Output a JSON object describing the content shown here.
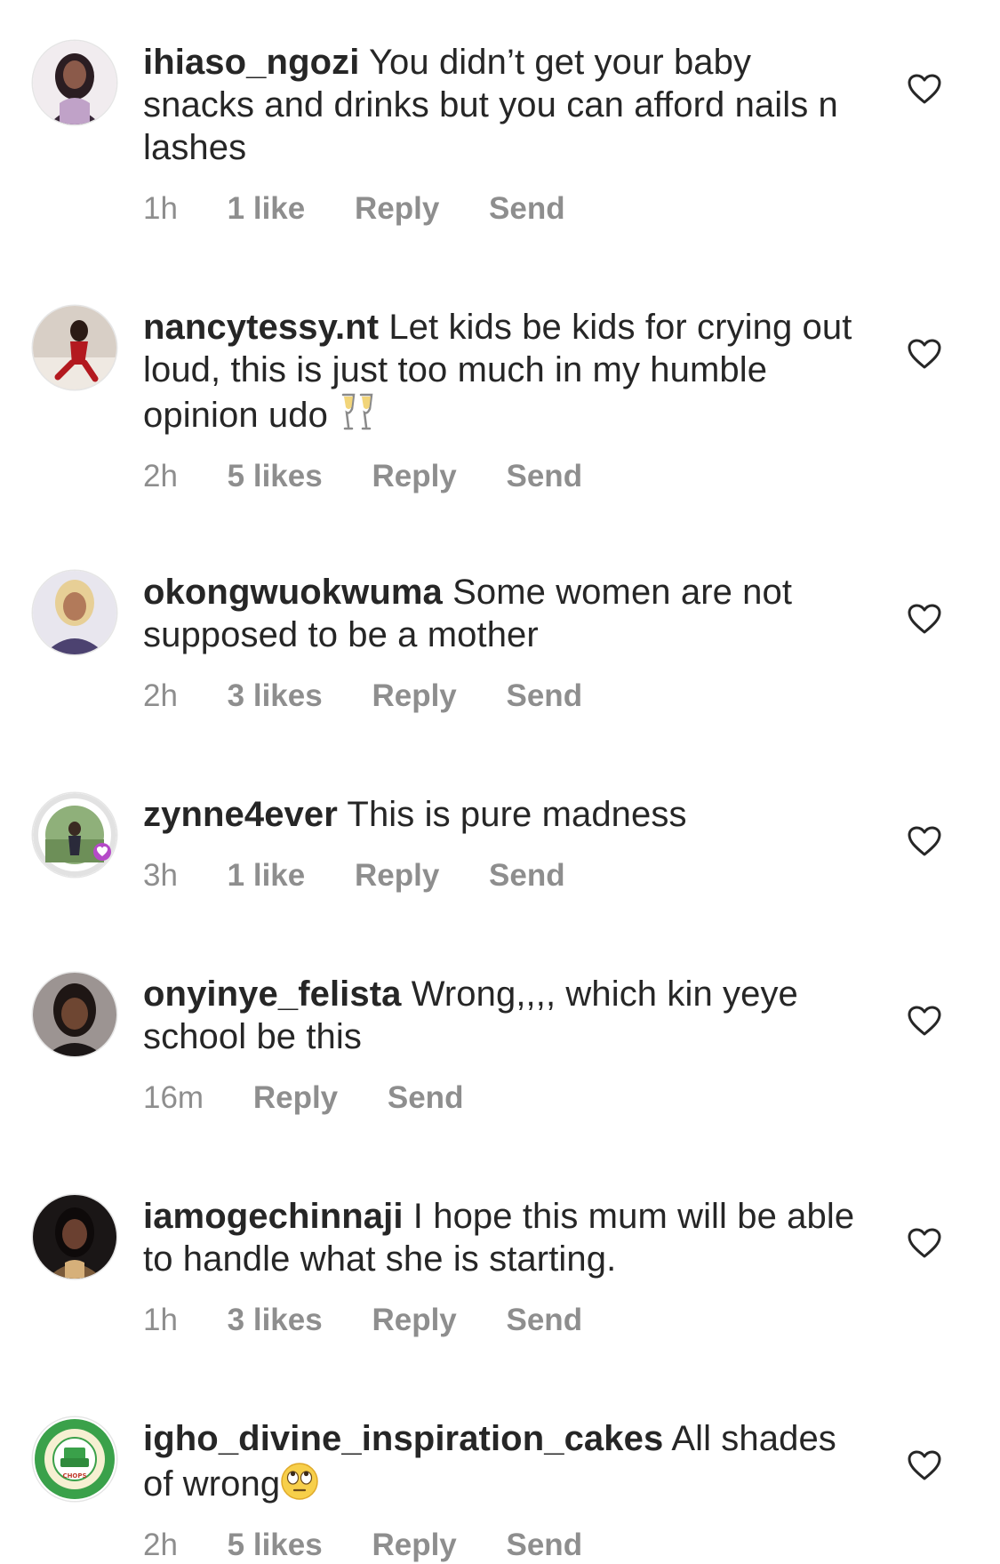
{
  "comments": [
    {
      "username": "ihiaso_ngozi",
      "text": "You didn’t get your baby snacks and drinks but you can afford nails n lashes",
      "time": "1h",
      "likes": "1 like",
      "reply": "Reply",
      "send": "Send",
      "avatar_color": "#d9c9d6"
    },
    {
      "username": "nancytessy.nt",
      "text": "Let kids be kids for crying out loud, this is just too much in my humble opinion  udo ",
      "emoji": "clinking-glasses",
      "time": "2h",
      "likes": "5 likes",
      "reply": "Reply",
      "send": "Send",
      "avatar_color": "#8a3a3a"
    },
    {
      "username": "okongwuokwuma",
      "text": "Some women are not supposed to be a mother",
      "time": "2h",
      "likes": "3 likes",
      "reply": "Reply",
      "send": "Send",
      "avatar_color": "#5a4a7a"
    },
    {
      "username": "zynne4ever",
      "text": "This is pure madness",
      "time": "3h",
      "likes": "1 like",
      "reply": "Reply",
      "send": "Send",
      "avatar_color": "#6b8f5a"
    },
    {
      "username": "onyinye_felista",
      "text": "Wrong,,,, which kin yeye school be this",
      "time": "16m",
      "likes": "",
      "reply": "Reply",
      "send": "Send",
      "avatar_color": "#3a3030"
    },
    {
      "username": "iamogechinnaji",
      "text": "I hope this mum will be able to handle what she is starting.",
      "time": "1h",
      "likes": "3 likes",
      "reply": "Reply",
      "send": "Send",
      "avatar_color": "#2a2222"
    },
    {
      "username": "igho_divine_inspiration_cakes",
      "text": "All shades of wrong",
      "emoji": "rolling-eyes",
      "time": "2h",
      "likes": "5 likes",
      "reply": "Reply",
      "send": "Send",
      "avatar_color": "#3aa14a"
    }
  ],
  "icons": {
    "like": "heart-outline-icon"
  },
  "colors": {
    "text": "#262626",
    "meta": "#8e8e8e"
  }
}
